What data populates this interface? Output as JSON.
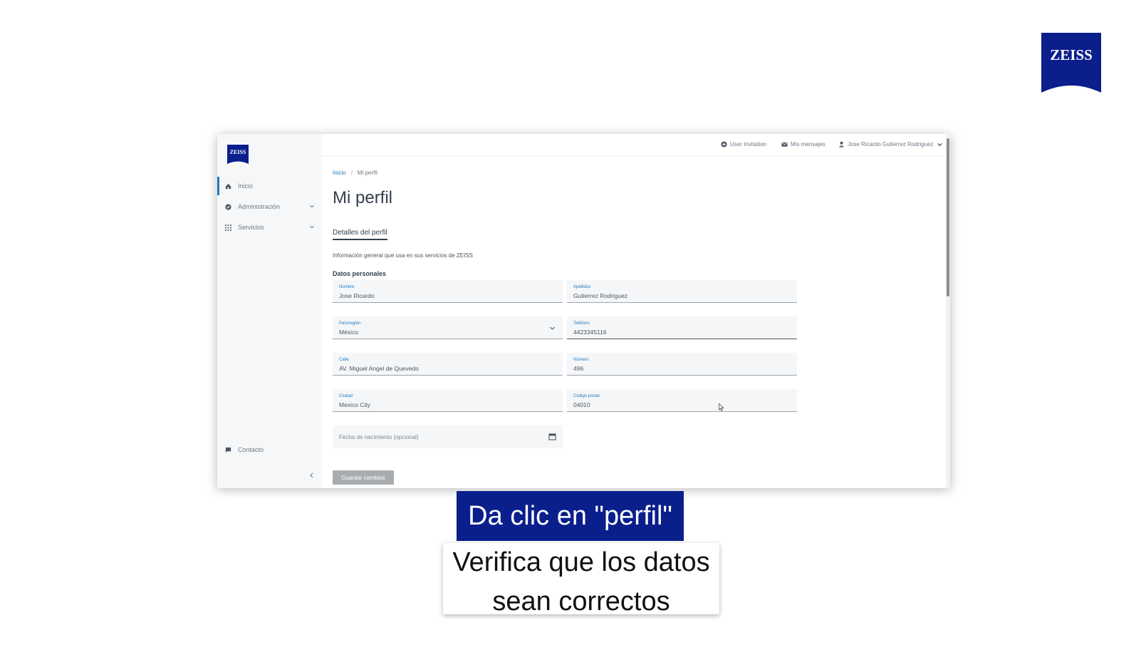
{
  "brand": {
    "logo_text": "ZEISS",
    "color": "#0a1e8c"
  },
  "app": {
    "logo_text": "ZEISS",
    "sidebar": {
      "items": [
        {
          "label": "Inicio",
          "icon": "home-icon",
          "active": true
        },
        {
          "label": "Administración",
          "icon": "shield-check-icon",
          "expandable": true
        },
        {
          "label": "Servicios",
          "icon": "grid-icon",
          "expandable": true
        }
      ],
      "contact": {
        "label": "Contacto",
        "icon": "chat-icon"
      }
    },
    "topbar": {
      "invitation": {
        "label": "User Invitation",
        "icon": "plus-circle-icon"
      },
      "messages": {
        "label": "Mis mensajes",
        "icon": "envelope-icon"
      },
      "user": {
        "label": "Jose Ricardo Gutierrez Rodriguez",
        "icon": "user-icon"
      }
    },
    "breadcrumb": {
      "home": "Inicio",
      "separator": "/",
      "current": "Mi perfil"
    },
    "page_title": "Mi perfil",
    "tab": "Detalles del perfil",
    "info_text": "Información general que usa en sus servicios de ZEISS",
    "section_title": "Datos personales",
    "fields": {
      "nombre": {
        "label": "Nombre",
        "value": "Jose Ricardo"
      },
      "apellidos": {
        "label": "Apellidos",
        "value": "Gutierrez Rodriguez"
      },
      "pais": {
        "label": "País/región",
        "value": "México"
      },
      "telefono": {
        "label": "Teléfono",
        "value": "4423345116"
      },
      "calle": {
        "label": "Calle",
        "value": "AV. Miguel Angel de Quevedo"
      },
      "numero": {
        "label": "Número",
        "value": "496"
      },
      "ciudad": {
        "label": "Ciudad",
        "value": "Mexico City"
      },
      "codigo_postal": {
        "label": "Código postal",
        "value": "04010"
      },
      "fecha": {
        "placeholder": "Fecha de nacimiento (opcional)"
      }
    },
    "save_button": "Guardar cambios",
    "accent": "#1f7ac4"
  },
  "captions": {
    "main": "Da clic en \"perfil\"",
    "sub_line1": "Verifica que los datos",
    "sub_line2": "sean correctos"
  }
}
